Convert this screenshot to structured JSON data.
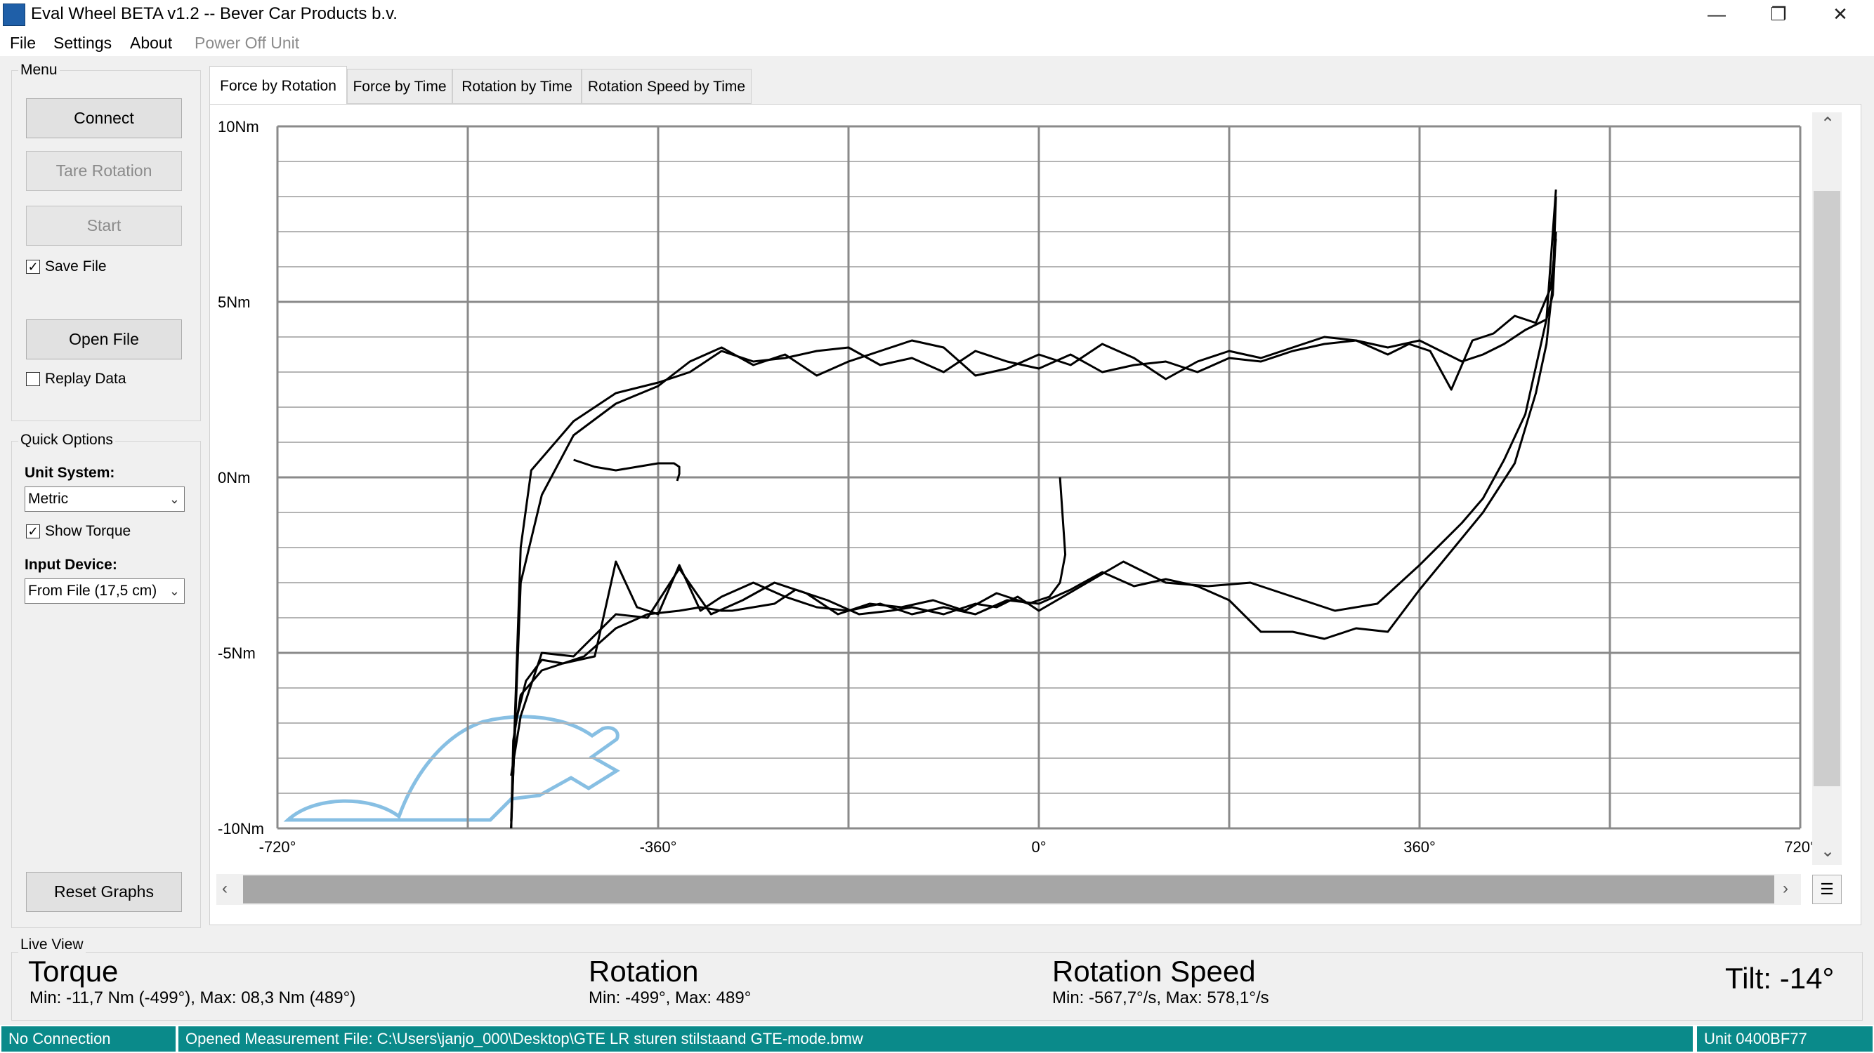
{
  "window": {
    "title": "Eval Wheel BETA v1.2 -- Bever Car Products b.v.",
    "controls": {
      "minimize": "—",
      "maximize": "❐",
      "close": "✕"
    }
  },
  "menubar": [
    "File",
    "Settings",
    "About",
    "Power Off Unit"
  ],
  "menu_group": {
    "title": "Menu",
    "connect": "Connect",
    "tare_rotation": "Tare Rotation",
    "start": "Start",
    "save_file": {
      "label": "Save File",
      "checked": true
    },
    "open_file": "Open File",
    "replay_data": {
      "label": "Replay Data",
      "checked": false
    }
  },
  "quick_options": {
    "title": "Quick Options",
    "unit_system_label": "Unit System:",
    "unit_system_value": "Metric",
    "show_torque": {
      "label": "Show Torque",
      "checked": true
    },
    "input_device_label": "Input Device:",
    "input_device_value": "From File (17,5 cm)",
    "reset_graphs": "Reset Graphs"
  },
  "tabs": [
    "Force by Rotation",
    "Force by Time",
    "Rotation by Time",
    "Rotation Speed by Time"
  ],
  "active_tab": 0,
  "chart_data": {
    "type": "line",
    "xlabel": "",
    "ylabel": "",
    "xlim": [
      -720,
      720
    ],
    "ylim": [
      -10,
      10
    ],
    "x_ticks": [
      "-720°",
      "-360°",
      "0°",
      "360°",
      "720°"
    ],
    "y_ticks": [
      "10Nm",
      "5Nm",
      "0Nm",
      "-5Nm",
      "-10Nm"
    ],
    "grid": true,
    "series": [
      {
        "x": [
          -499,
          -497,
          -490,
          -470,
          -430,
          -400,
          -370,
          -340,
          -320,
          -300,
          -290,
          -250,
          -230,
          -200,
          -170,
          -140,
          -120,
          -90,
          -60,
          -40,
          -20,
          0,
          40,
          80,
          120,
          160,
          200,
          240,
          280,
          320,
          360,
          400,
          420,
          440,
          460,
          480,
          489
        ],
        "values": [
          -10,
          -7.5,
          -6.2,
          -5.5,
          -5.1,
          -4.3,
          -3.9,
          -3.8,
          -3.7,
          -3.8,
          -3.8,
          -3.6,
          -3.2,
          -3.5,
          -3.9,
          -3.8,
          -3.7,
          -3.9,
          -3.6,
          -3.7,
          -3.4,
          -3.8,
          -3.1,
          -2.4,
          -3.0,
          -3.1,
          -3.0,
          -3.4,
          -3.8,
          -3.6,
          -2.5,
          -1.3,
          -0.6,
          0.5,
          1.8,
          4.5,
          8.2
        ]
      },
      {
        "x": [
          489,
          486,
          480,
          460,
          440,
          420,
          400,
          380,
          360,
          330,
          300,
          270,
          240,
          210,
          180,
          150,
          120,
          90,
          60,
          30,
          0,
          -30,
          -60,
          -90,
          -120,
          -150,
          -180,
          -210,
          -240,
          -270,
          -300,
          -330,
          -360,
          -400,
          -440,
          -480,
          -490,
          -499
        ],
        "values": [
          7.0,
          5.2,
          4.5,
          4.2,
          3.8,
          3.5,
          3.3,
          3.6,
          3.9,
          3.7,
          3.9,
          3.8,
          3.6,
          3.3,
          3.4,
          3.0,
          3.3,
          3.2,
          3.0,
          3.5,
          3.1,
          3.3,
          3.6,
          3.0,
          3.4,
          3.2,
          3.7,
          3.6,
          3.4,
          3.3,
          3.6,
          3.0,
          2.7,
          2.4,
          1.6,
          0.2,
          -2.0,
          -10
        ]
      },
      {
        "x": [
          -499,
          -495,
          -485,
          -470,
          -450,
          -420,
          -400,
          -380,
          -360,
          -340,
          -320,
          -300,
          -270,
          -240,
          -210,
          -180,
          -150,
          -120,
          -90,
          -60,
          -30,
          0,
          30,
          60,
          90,
          120,
          150,
          180,
          210,
          240,
          270,
          300,
          330,
          360,
          390,
          420,
          450,
          470,
          480,
          486,
          489
        ],
        "values": [
          -9.8,
          -7.0,
          -5.8,
          -5.2,
          -5.3,
          -5.1,
          -2.4,
          -3.7,
          -3.9,
          -2.5,
          -3.8,
          -3.4,
          -3.0,
          -3.4,
          -3.7,
          -3.8,
          -3.6,
          -3.9,
          -3.7,
          -3.9,
          -3.5,
          -3.6,
          -3.2,
          -2.7,
          -3.1,
          -2.9,
          -3.1,
          -3.5,
          -4.4,
          -4.4,
          -4.6,
          -4.3,
          -4.4,
          -3.2,
          -2.1,
          -1.0,
          0.4,
          2.4,
          3.8,
          5.5,
          8.0
        ]
      },
      {
        "x": [
          489,
          484,
          470,
          450,
          430,
          410,
          390,
          370,
          350,
          330,
          300,
          270,
          240,
          210,
          180,
          150,
          120,
          90,
          60,
          30,
          0,
          -30,
          -60,
          -90,
          -120,
          -150,
          -180,
          -210,
          -240,
          -270,
          -300,
          -330,
          -360,
          -400,
          -440,
          -470,
          -490,
          -499
        ],
        "values": [
          6.8,
          5.4,
          4.4,
          4.6,
          4.1,
          3.9,
          2.5,
          3.6,
          3.8,
          3.5,
          3.9,
          4.0,
          3.7,
          3.4,
          3.6,
          3.3,
          2.8,
          3.4,
          3.8,
          3.2,
          3.5,
          3.1,
          2.9,
          3.7,
          3.9,
          3.6,
          3.3,
          2.9,
          3.5,
          3.2,
          3.7,
          3.3,
          2.6,
          2.1,
          1.2,
          -0.5,
          -3.0,
          -10
        ]
      },
      {
        "x": [
          -499,
          -490,
          -470,
          -440,
          -400,
          -370,
          -340,
          -310,
          -280,
          -250,
          -220,
          -190,
          -160,
          -130,
          -100,
          -70,
          -40,
          -10,
          10,
          20,
          25,
          20
        ],
        "values": [
          -8.5,
          -6.8,
          -5.0,
          -5.1,
          -3.9,
          -4.0,
          -2.6,
          -3.9,
          -3.5,
          -3.0,
          -3.3,
          -3.9,
          -3.6,
          -3.7,
          -3.5,
          -3.8,
          -3.3,
          -3.6,
          -3.4,
          -3.0,
          -2.2,
          0
        ]
      },
      {
        "x": [
          -440,
          -420,
          -400,
          -380,
          -360,
          -345,
          -340,
          -340,
          -342
        ],
        "values": [
          0.5,
          0.3,
          0.2,
          0.3,
          0.4,
          0.4,
          0.3,
          0.1,
          -0.1
        ]
      }
    ]
  },
  "live_view": {
    "title": "Live View",
    "torque": {
      "label": "Torque",
      "minmax": "Min: -11,7 Nm (-499°), Max: 08,3 Nm (489°)"
    },
    "rotation": {
      "label": "Rotation",
      "minmax": "Min: -499°, Max: 489°"
    },
    "rotation_speed": {
      "label": "Rotation Speed",
      "minmax": "Min: -567,7°/s, Max: 578,1°/s"
    },
    "tilt": "Tilt: -14°"
  },
  "statusbar": {
    "connection": "No Connection",
    "message": "Opened Measurement File: C:\\Users\\janjo_000\\Desktop\\GTE LR sturen stilstaand GTE-mode.bmw",
    "unit": "Unit 0400BF77"
  },
  "colors": {
    "status_bg": "#0a8a8a",
    "line": "#000000",
    "grid": "#b4b4b4",
    "watermark": "#7ab8e0"
  }
}
